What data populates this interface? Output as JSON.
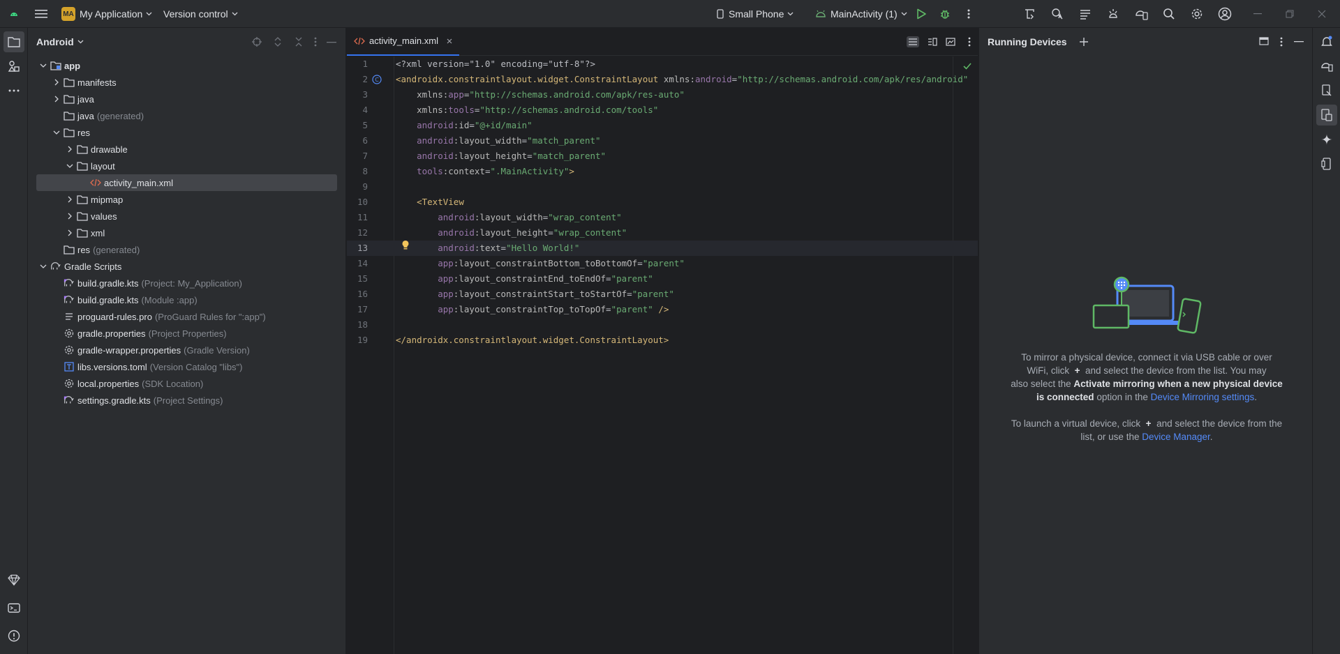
{
  "titlebar": {
    "project_badge": "MA",
    "project_name": "My Application",
    "vcs_label": "Version control",
    "device": "Small Phone",
    "run_config": "MainActivity (1)"
  },
  "project_panel": {
    "view_mode": "Android",
    "tree": [
      {
        "label": "app",
        "extra": "",
        "depth": 0,
        "expanded": true,
        "icon": "module-folder-icon",
        "bold": true
      },
      {
        "label": "manifests",
        "extra": "",
        "depth": 1,
        "expanded": false,
        "icon": "folder-icon"
      },
      {
        "label": "java",
        "extra": "",
        "depth": 1,
        "expanded": false,
        "icon": "folder-icon"
      },
      {
        "label": "java",
        "extra": "(generated)",
        "depth": 1,
        "leaf": true,
        "icon": "folder-icon"
      },
      {
        "label": "res",
        "extra": "",
        "depth": 1,
        "expanded": true,
        "icon": "folder-icon"
      },
      {
        "label": "drawable",
        "extra": "",
        "depth": 2,
        "expanded": false,
        "icon": "folder-icon"
      },
      {
        "label": "layout",
        "extra": "",
        "depth": 2,
        "expanded": true,
        "icon": "folder-icon"
      },
      {
        "label": "activity_main.xml",
        "extra": "",
        "depth": 3,
        "leaf": true,
        "icon": "xml-file-icon",
        "selected": true
      },
      {
        "label": "mipmap",
        "extra": "",
        "depth": 2,
        "expanded": false,
        "icon": "folder-icon"
      },
      {
        "label": "values",
        "extra": "",
        "depth": 2,
        "expanded": false,
        "icon": "folder-icon"
      },
      {
        "label": "xml",
        "extra": "",
        "depth": 2,
        "expanded": false,
        "icon": "folder-icon"
      },
      {
        "label": "res",
        "extra": "(generated)",
        "depth": 1,
        "leaf": true,
        "icon": "folder-icon"
      },
      {
        "label": "Gradle Scripts",
        "extra": "",
        "depth": 0,
        "expanded": true,
        "icon": "gradle-icon"
      },
      {
        "label": "build.gradle.kts",
        "extra": "(Project: My_Application)",
        "depth": 1,
        "leaf": true,
        "icon": "kotlin-gradle-icon"
      },
      {
        "label": "build.gradle.kts",
        "extra": "(Module :app)",
        "depth": 1,
        "leaf": true,
        "icon": "kotlin-gradle-icon"
      },
      {
        "label": "proguard-rules.pro",
        "extra": "(ProGuard Rules for \":app\")",
        "depth": 1,
        "leaf": true,
        "icon": "text-file-icon"
      },
      {
        "label": "gradle.properties",
        "extra": "(Project Properties)",
        "depth": 1,
        "leaf": true,
        "icon": "settings-file-icon"
      },
      {
        "label": "gradle-wrapper.properties",
        "extra": "(Gradle Version)",
        "depth": 1,
        "leaf": true,
        "icon": "settings-file-icon"
      },
      {
        "label": "libs.versions.toml",
        "extra": "(Version Catalog \"libs\")",
        "depth": 1,
        "leaf": true,
        "icon": "toml-file-icon"
      },
      {
        "label": "local.properties",
        "extra": "(SDK Location)",
        "depth": 1,
        "leaf": true,
        "icon": "settings-file-icon"
      },
      {
        "label": "settings.gradle.kts",
        "extra": "(Project Settings)",
        "depth": 1,
        "leaf": true,
        "icon": "kotlin-gradle-icon"
      }
    ]
  },
  "editor": {
    "tab_label": "activity_main.xml",
    "current_line": 13,
    "lines": [
      [
        [
          "plain",
          "<?xml version=\"1.0\" encoding=\"utf-8\"?>"
        ]
      ],
      [
        [
          "tag",
          "<androidx.constraintlayout.widget.ConstraintLayout "
        ],
        [
          "attr",
          "xmlns:"
        ],
        [
          "ns",
          "android"
        ],
        [
          "plain",
          "="
        ],
        [
          "val",
          "\"http://schemas.android.com/apk/res/android\""
        ]
      ],
      [
        [
          "plain",
          "    "
        ],
        [
          "attr",
          "xmlns:"
        ],
        [
          "ns",
          "app"
        ],
        [
          "plain",
          "="
        ],
        [
          "val",
          "\"http://schemas.android.com/apk/res-auto\""
        ]
      ],
      [
        [
          "plain",
          "    "
        ],
        [
          "attr",
          "xmlns:"
        ],
        [
          "ns",
          "tools"
        ],
        [
          "plain",
          "="
        ],
        [
          "val",
          "\"http://schemas.android.com/tools\""
        ]
      ],
      [
        [
          "plain",
          "    "
        ],
        [
          "ns",
          "android"
        ],
        [
          "attr",
          ":id"
        ],
        [
          "plain",
          "="
        ],
        [
          "val",
          "\"@+id/main\""
        ]
      ],
      [
        [
          "plain",
          "    "
        ],
        [
          "ns",
          "android"
        ],
        [
          "attr",
          ":layout_width"
        ],
        [
          "plain",
          "="
        ],
        [
          "val",
          "\"match_parent\""
        ]
      ],
      [
        [
          "plain",
          "    "
        ],
        [
          "ns",
          "android"
        ],
        [
          "attr",
          ":layout_height"
        ],
        [
          "plain",
          "="
        ],
        [
          "val",
          "\"match_parent\""
        ]
      ],
      [
        [
          "plain",
          "    "
        ],
        [
          "ns",
          "tools"
        ],
        [
          "attr",
          ":context"
        ],
        [
          "plain",
          "="
        ],
        [
          "val",
          "\".MainActivity\""
        ],
        [
          "tag",
          ">"
        ]
      ],
      [],
      [
        [
          "plain",
          "    "
        ],
        [
          "tag",
          "<TextView"
        ]
      ],
      [
        [
          "plain",
          "        "
        ],
        [
          "ns",
          "android"
        ],
        [
          "attr",
          ":layout_width"
        ],
        [
          "plain",
          "="
        ],
        [
          "val",
          "\"wrap_content\""
        ]
      ],
      [
        [
          "plain",
          "        "
        ],
        [
          "ns",
          "android"
        ],
        [
          "attr",
          ":layout_height"
        ],
        [
          "plain",
          "="
        ],
        [
          "val",
          "\"wrap_content\""
        ]
      ],
      [
        [
          "plain",
          "        "
        ],
        [
          "ns",
          "android"
        ],
        [
          "attr",
          ":text"
        ],
        [
          "plain",
          "="
        ],
        [
          "val",
          "\"Hello World!\""
        ]
      ],
      [
        [
          "plain",
          "        "
        ],
        [
          "ns",
          "app"
        ],
        [
          "attr",
          ":layout_constraintBottom_toBottomOf"
        ],
        [
          "plain",
          "="
        ],
        [
          "val",
          "\"parent\""
        ]
      ],
      [
        [
          "plain",
          "        "
        ],
        [
          "ns",
          "app"
        ],
        [
          "attr",
          ":layout_constraintEnd_toEndOf"
        ],
        [
          "plain",
          "="
        ],
        [
          "val",
          "\"parent\""
        ]
      ],
      [
        [
          "plain",
          "        "
        ],
        [
          "ns",
          "app"
        ],
        [
          "attr",
          ":layout_constraintStart_toStartOf"
        ],
        [
          "plain",
          "="
        ],
        [
          "val",
          "\"parent\""
        ]
      ],
      [
        [
          "plain",
          "        "
        ],
        [
          "ns",
          "app"
        ],
        [
          "attr",
          ":layout_constraintTop_toTopOf"
        ],
        [
          "plain",
          "="
        ],
        [
          "val",
          "\"parent\""
        ],
        [
          "tag",
          " />"
        ]
      ],
      [],
      [
        [
          "tag",
          "</androidx.constraintlayout.widget.ConstraintLayout>"
        ]
      ]
    ]
  },
  "running_devices": {
    "title": "Running Devices",
    "msg1_a": "To mirror a physical device, connect it via USB cable or over",
    "msg1_b": "WiFi, click",
    "msg1_c": "and select the device from the list. You may",
    "msg1_d": "also select the",
    "msg1_bold": "Activate mirroring when a new physical device is connected",
    "msg1_e": "option in the",
    "msg1_link": "Device Mirroring settings",
    "msg2_a": "To launch a virtual device, click",
    "msg2_b": "and select the device from the list, or use the",
    "msg2_link": "Device Manager"
  }
}
